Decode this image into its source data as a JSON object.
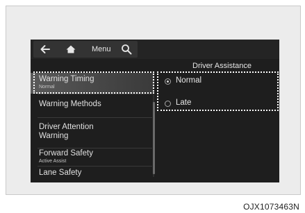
{
  "header": {
    "back_icon": "back-arrow-icon",
    "home_icon": "home-icon",
    "menu_label": "Menu",
    "search_icon": "search-icon"
  },
  "section_title": "Driver Assistance",
  "menu": {
    "items": [
      {
        "label": "Warning Timing",
        "sub": "Normal",
        "selected": true
      },
      {
        "label": "Warning Methods",
        "sub": ""
      },
      {
        "label": "Driver Attention",
        "label2": "Warning",
        "sub": ""
      },
      {
        "label": "Forward Safety",
        "sub": "Active Assist"
      },
      {
        "label": "Lane Safety",
        "sub": ""
      }
    ]
  },
  "options": [
    {
      "label": "Normal",
      "selected": true
    },
    {
      "label": "Late",
      "selected": false
    }
  ],
  "figure_code": "OJX1073463N",
  "colors": {
    "screen_bg": "#1e1e1e",
    "selected_bg": "#5a5a5a",
    "focus_outline": "#ffffff"
  }
}
